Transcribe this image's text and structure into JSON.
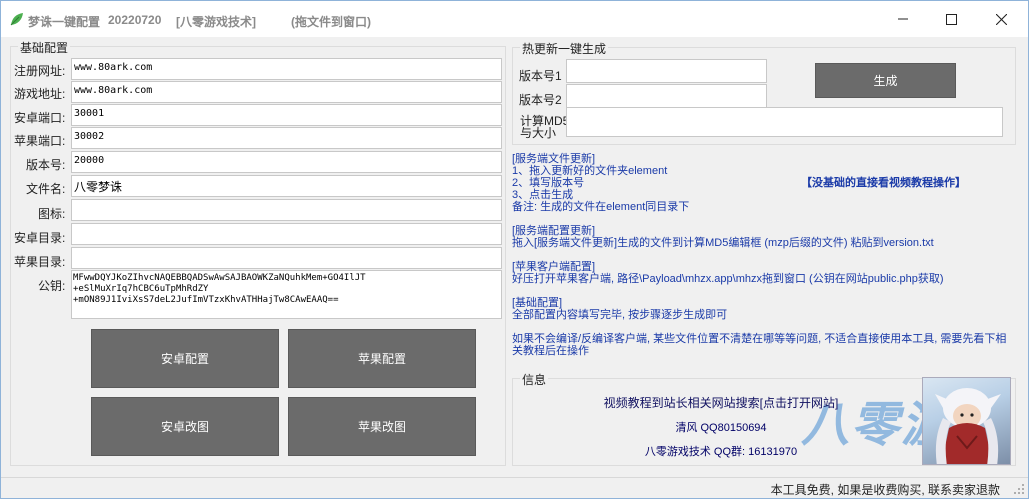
{
  "titlebar": {
    "app_name": "梦诛一键配置",
    "version": "20220720",
    "studio": "[八零游戏技术]",
    "hint": "(拖文件到窗口)",
    "minimize_icon": "minimize-icon",
    "maximize_icon": "maximize-icon",
    "close_icon": "close-icon"
  },
  "basic": {
    "group_title": "基础配置",
    "fields": [
      {
        "label": "注册网址:",
        "value": "www.80ark.com"
      },
      {
        "label": "游戏地址:",
        "value": "www.80ark.com"
      },
      {
        "label": "安卓端口:",
        "value": "30001"
      },
      {
        "label": "苹果端口:",
        "value": "30002"
      },
      {
        "label": "版本号:",
        "value": "20000"
      },
      {
        "label": "文件名:",
        "value": "八零梦诛"
      },
      {
        "label": "图标:",
        "value": ""
      },
      {
        "label": "安卓目录:",
        "value": ""
      },
      {
        "label": "苹果目录:",
        "value": ""
      }
    ],
    "pubkey_label": "公钥:",
    "pubkey_value": "MFwwDQYJKoZIhvcNAQEBBQADSwAwSAJBAOWKZaNQuhkMem+GO4IlJT\n+eSlMuXrIq7hCBC6uTpMhRdZY\n+mON89J1IviXsS7deL2JufImVTzxKhvATHHajTw8CAwEAAQ==",
    "buttons": [
      "安卓配置",
      "苹果配置",
      "安卓改图",
      "苹果改图"
    ]
  },
  "hotupdate": {
    "group_title": "热更新一键生成",
    "version1_label": "版本号1",
    "version2_label": "版本号2",
    "md5_label_line1": "计算MD5",
    "md5_label_line2": "与大小",
    "version1_value": "",
    "version2_value": "",
    "md5_value": "",
    "generate_label": "生成"
  },
  "instructions": {
    "server_update_title": "[服务端文件更新]",
    "server_update_step1": "1、拖入更新好的文件夹element",
    "server_update_step2": "2、填写版本号",
    "server_update_step3": "3、点击生成",
    "server_update_note": "备注: 生成的文件在element同目录下",
    "tutorial_link": "【没基础的直接看视频教程操作】",
    "server_config_title": "[服务端配置更新]",
    "server_config_text": "拖入[服务端文件更新]生成的文件到计算MD5编辑框 (mzp后缀的文件) 粘贴到version.txt",
    "apple_client_title": "[苹果客户端配置]",
    "apple_client_text": "好压打开苹果客户端, 路径\\Payload\\mhzx.app\\mhzx拖到窗口 (公钥在网站public.php获取)",
    "basic_config_title": "[基础配置]",
    "basic_config_text": "全部配置内容填写完毕, 按步骤逐步生成即可",
    "warning_text": "如果不会编译/反编译客户端, 某些文件位置不清楚在哪等等问题, 不适合直接使用本工具, 需要先看下相关教程后在操作"
  },
  "info": {
    "group_title": "信息",
    "link": "视频教程到站长相关网站搜索[点击打开网站]",
    "contact_qq": "清风  QQ80150694",
    "group_qq": "八零游戏技术  QQ群: 16131970",
    "watermark": "八零游"
  },
  "statusbar": {
    "text": "本工具免费, 如果是收费购买, 联系卖家退款"
  },
  "colors": {
    "accent_text": "#1a3aa8",
    "button_dark": "#6b6b6b",
    "app_icon": "#4caf50"
  }
}
